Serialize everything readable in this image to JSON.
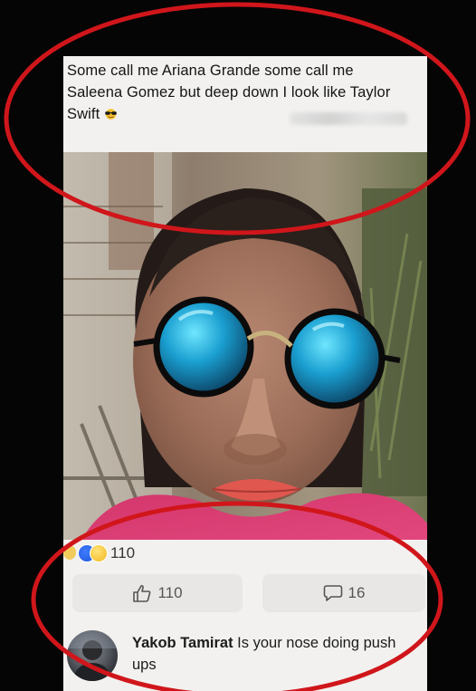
{
  "post": {
    "text": "Some call me Ariana Grande some call me Saleena Gomez but deep down I look like Taylor Swift",
    "emoji": "sunglasses-emoji"
  },
  "reactions": {
    "icons": [
      "love-icon",
      "like-icon",
      "sad-icon"
    ],
    "count": "110"
  },
  "actions": {
    "like_count": "110",
    "comment_count": "16"
  },
  "comment": {
    "author": "Yakob Tamirat",
    "text": "Is your nose doing push ups"
  },
  "colors": {
    "annotation_red": "#d0161b",
    "card_background": "#f2f1ef",
    "page_background": "#050505"
  }
}
